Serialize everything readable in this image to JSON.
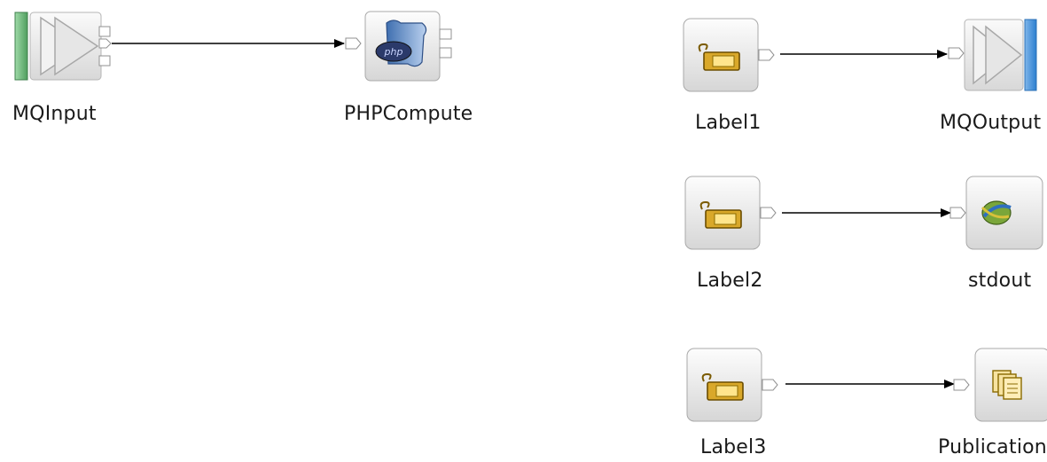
{
  "flow": {
    "nodes": {
      "mqinput": "MQInput",
      "phpcompute": "PHPCompute",
      "label1": "Label1",
      "mqoutput": "MQOutput",
      "label2": "Label2",
      "stdout": "stdout",
      "label3": "Label3",
      "publication": "Publication"
    },
    "icons": {
      "mqinput": "mq-input-icon",
      "phpcompute": "php-script-icon",
      "label": "label-tag-icon",
      "mqoutput": "mq-output-icon",
      "stdout": "stdout-globe-icon",
      "publication": "publication-pages-icon"
    },
    "colors": {
      "input_bar": "#6fbf7f",
      "output_bar": "#3a8fd8",
      "wire": "#000000",
      "tag": "#c89a1c"
    }
  }
}
